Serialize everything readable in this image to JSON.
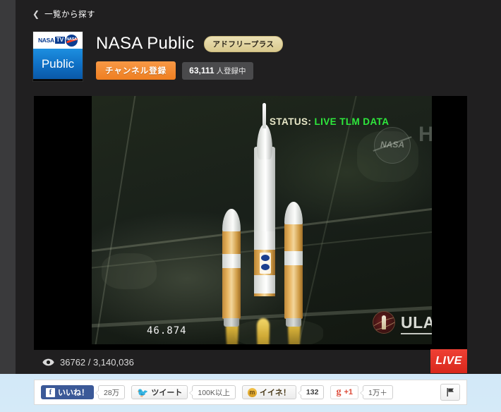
{
  "nav": {
    "back_label": "一覧から探す",
    "back_icon": "chevron-left-icon"
  },
  "channel": {
    "logo": {
      "nasa_word": "NASA",
      "tv_word": "TV",
      "meatball_text": "NASA",
      "public_word": "Public"
    },
    "name": "NASA Public",
    "badge": "アドフリープラス",
    "subscribe_label": "チャンネル登録",
    "subscriber_count": "63,111",
    "subscriber_suffix": "人登録中"
  },
  "video": {
    "status_label": "STATUS:",
    "status_value": "LIVE TLM DATA",
    "hd_watermark": "HD",
    "meatball_text": "NASA",
    "telemetry": "46.874",
    "sponsor_logo": "ULA"
  },
  "stats": {
    "eye_icon": "eye-icon",
    "viewers": "36762 / 3,140,036",
    "live_label": "LIVE"
  },
  "share": {
    "facebook": {
      "icon": "facebook-icon",
      "label": "いいね！",
      "count": "28万"
    },
    "twitter": {
      "icon": "twitter-bird-icon",
      "label": "ツイート",
      "count": "100K以上"
    },
    "mixi": {
      "icon": "mixi-icon",
      "label": "イイネ！",
      "count": "132"
    },
    "google": {
      "icon": "google-plus-icon",
      "mark": "g",
      "plus": "+1",
      "count": "1万＋"
    },
    "report": {
      "icon": "flag-icon"
    }
  },
  "colors": {
    "panel_bg": "#201f20",
    "accent_orange": "#ef7f21",
    "live_red": "#d9281c",
    "status_green": "#2ee83c",
    "badge_gold": "#d9c98e",
    "facebook_blue": "#3b5998",
    "page_blue": "#b9d8ef"
  }
}
